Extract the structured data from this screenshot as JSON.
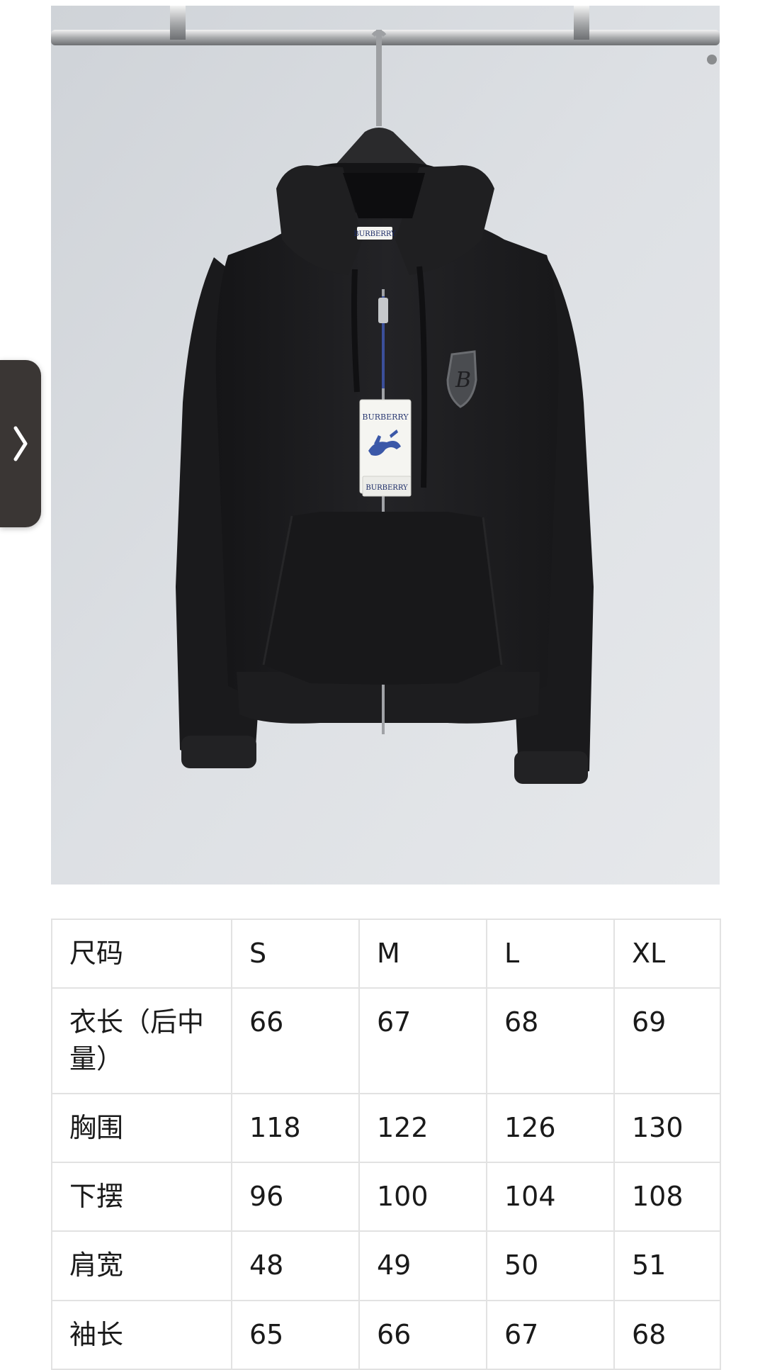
{
  "navigation": {
    "prev_icon": "chevron-right-icon"
  },
  "photo": {
    "hanger_tag_brand": "BURBERRY",
    "swing_tag_brand_top": "BURBERRY",
    "swing_tag_brand_bottom": "BURBERRY",
    "badge_letter": "B",
    "garment_color": "#1c1c1e"
  },
  "size_table": {
    "header": {
      "label": "尺码",
      "sizes": [
        "S",
        "M",
        "L",
        "XL"
      ]
    },
    "rows": [
      {
        "label": "衣长（后中量）",
        "values": [
          "66",
          "67",
          "68",
          "69"
        ]
      },
      {
        "label": "胸围",
        "values": [
          "118",
          "122",
          "126",
          "130"
        ]
      },
      {
        "label": "下摆",
        "values": [
          "96",
          "100",
          "104",
          "108"
        ]
      },
      {
        "label": "肩宽",
        "values": [
          "48",
          "49",
          "50",
          "51"
        ]
      },
      {
        "label": "袖长",
        "values": [
          "65",
          "66",
          "67",
          "68"
        ]
      }
    ]
  }
}
